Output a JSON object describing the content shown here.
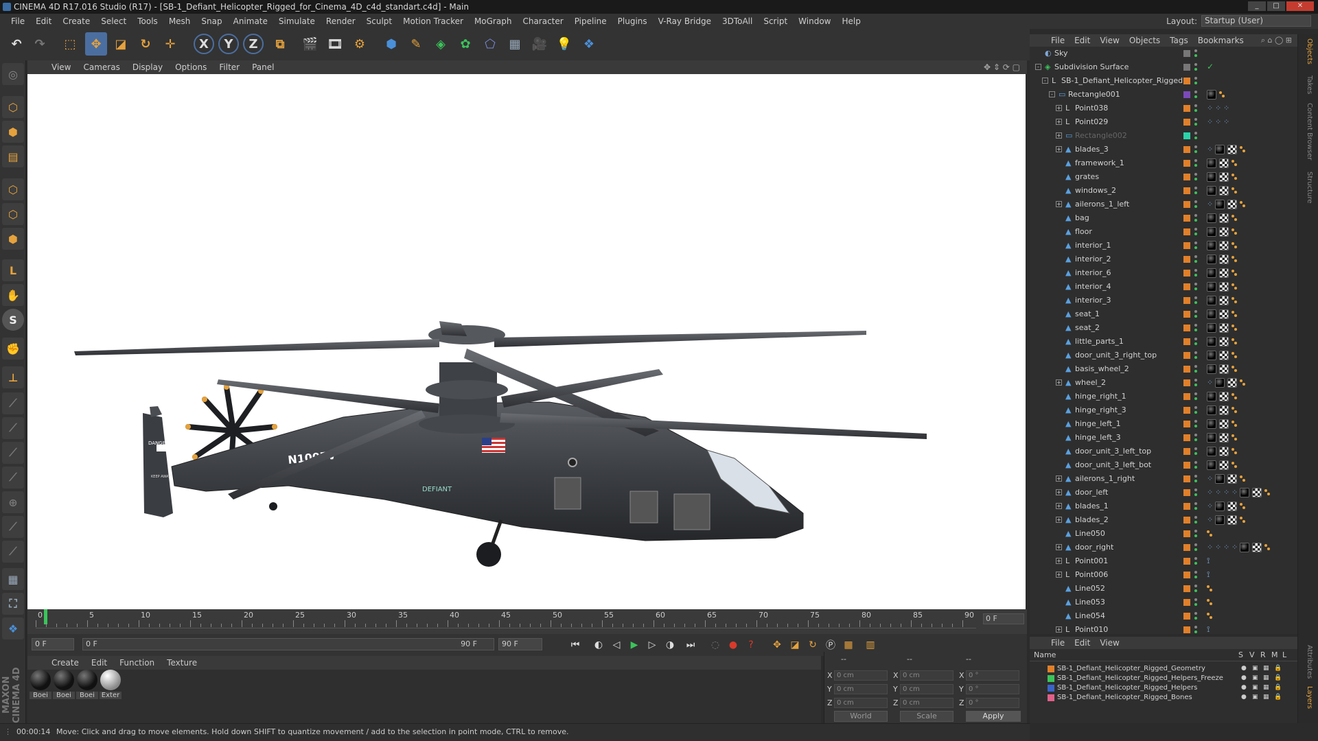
{
  "window": {
    "title": "CINEMA 4D R17.016 Studio (R17) - [SB-1_Defiant_Helicopter_Rigged_for_Cinema_4D_c4d_standart.c4d] - Main"
  },
  "menubar": {
    "items": [
      "File",
      "Edit",
      "Create",
      "Select",
      "Tools",
      "Mesh",
      "Snap",
      "Animate",
      "Simulate",
      "Render",
      "Sculpt",
      "Motion Tracker",
      "MoGraph",
      "Character",
      "Pipeline",
      "Plugins",
      "V-Ray Bridge",
      "3DToAll",
      "Script",
      "Window",
      "Help"
    ],
    "layout_label": "Layout:",
    "layout_value": "Startup (User)"
  },
  "viewport": {
    "menu": [
      "View",
      "Cameras",
      "Display",
      "Options",
      "Filter",
      "Panel"
    ],
    "model_text": {
      "registration": "N100FV",
      "tail_marking": "DANGER",
      "tail_sub": "KEEP AWAY",
      "logo": "DEFIANT"
    }
  },
  "timeline": {
    "ticks": [
      "0",
      "5",
      "10",
      "15",
      "20",
      "25",
      "30",
      "35",
      "40",
      "45",
      "50",
      "55",
      "60",
      "65",
      "70",
      "75",
      "80",
      "85",
      "90"
    ],
    "frame_field": "0 F",
    "start_field": "0 F",
    "range_start": "0 F",
    "range_end": "90 F",
    "end_field": "90 F"
  },
  "materials": {
    "menu": [
      "Create",
      "Edit",
      "Function",
      "Texture"
    ],
    "items": [
      "Boei",
      "Boei",
      "Boei",
      "Exter"
    ]
  },
  "coords": {
    "header_a": "--",
    "header_b": "--",
    "header_c": "--",
    "rows": [
      {
        "a": "X",
        "av": "0 cm",
        "b": "X",
        "bv": "0 cm",
        "c": "X",
        "cv": "0 °"
      },
      {
        "a": "Y",
        "av": "0 cm",
        "b": "Y",
        "bv": "0 cm",
        "c": "Y",
        "cv": "0 °"
      },
      {
        "a": "Z",
        "av": "0 cm",
        "b": "Z",
        "bv": "0 cm",
        "c": "Z",
        "cv": "0 °"
      }
    ],
    "mode_world": "World",
    "mode_scale": "Scale",
    "apply": "Apply"
  },
  "status": {
    "time": "00:00:14",
    "message": "Move: Click and drag to move elements. Hold down SHIFT to quantize movement / add to the selection in point mode, CTRL to remove."
  },
  "object_manager": {
    "menu": [
      "File",
      "Edit",
      "View",
      "Objects",
      "Tags",
      "Bookmarks"
    ],
    "objects": [
      {
        "name": "Sky",
        "depth": 0,
        "expand": "",
        "icon": "sky",
        "sw": "gray",
        "tags": []
      },
      {
        "name": "Subdivision Surface",
        "depth": 0,
        "expand": "-",
        "icon": "subd",
        "sw": "gray",
        "tags": [
          "check"
        ]
      },
      {
        "name": "SB-1_Defiant_Helicopter_Rigged",
        "depth": 1,
        "expand": "-",
        "icon": "null",
        "sw": "orange",
        "tags": []
      },
      {
        "name": "Rectangle001",
        "depth": 2,
        "expand": "-",
        "icon": "spline",
        "sw": "purple",
        "tags": [
          "ph",
          "or"
        ]
      },
      {
        "name": "Point038",
        "depth": 3,
        "expand": "+",
        "icon": "null",
        "sw": "orange",
        "tags": [
          "dots"
        ]
      },
      {
        "name": "Point029",
        "depth": 3,
        "expand": "+",
        "icon": "null",
        "sw": "orange",
        "tags": [
          "dots"
        ]
      },
      {
        "name": "Rectangle002",
        "depth": 3,
        "expand": "+",
        "icon": "spline",
        "sw": "teal",
        "tags": [],
        "dim": true
      },
      {
        "name": "blades_3",
        "depth": 3,
        "expand": "+",
        "icon": "poly",
        "sw": "orange",
        "tags": [
          "dotsm",
          "ph",
          "ck",
          "or"
        ]
      },
      {
        "name": "framework_1",
        "depth": 3,
        "expand": "",
        "icon": "poly",
        "sw": "orange",
        "tags": [
          "ph",
          "ck",
          "or"
        ]
      },
      {
        "name": "grates",
        "depth": 3,
        "expand": "",
        "icon": "poly",
        "sw": "orange",
        "tags": [
          "ph",
          "ck",
          "or"
        ]
      },
      {
        "name": "windows_2",
        "depth": 3,
        "expand": "",
        "icon": "poly",
        "sw": "orange",
        "tags": [
          "ph",
          "ck",
          "or"
        ]
      },
      {
        "name": "ailerons_1_left",
        "depth": 3,
        "expand": "+",
        "icon": "poly",
        "sw": "orange",
        "tags": [
          "dotsm",
          "ph",
          "ck",
          "or"
        ]
      },
      {
        "name": "bag",
        "depth": 3,
        "expand": "",
        "icon": "poly",
        "sw": "orange",
        "tags": [
          "ph",
          "ck",
          "or"
        ]
      },
      {
        "name": "floor",
        "depth": 3,
        "expand": "",
        "icon": "poly",
        "sw": "orange",
        "tags": [
          "ph",
          "ck",
          "or"
        ]
      },
      {
        "name": "interior_1",
        "depth": 3,
        "expand": "",
        "icon": "poly",
        "sw": "orange",
        "tags": [
          "ph",
          "ck",
          "or"
        ]
      },
      {
        "name": "interior_2",
        "depth": 3,
        "expand": "",
        "icon": "poly",
        "sw": "orange",
        "tags": [
          "ph",
          "ck",
          "or"
        ]
      },
      {
        "name": "interior_6",
        "depth": 3,
        "expand": "",
        "icon": "poly",
        "sw": "orange",
        "tags": [
          "ph",
          "ck",
          "or"
        ]
      },
      {
        "name": "interior_4",
        "depth": 3,
        "expand": "",
        "icon": "poly",
        "sw": "orange",
        "tags": [
          "ph",
          "ck",
          "or"
        ]
      },
      {
        "name": "interior_3",
        "depth": 3,
        "expand": "",
        "icon": "poly",
        "sw": "orange",
        "tags": [
          "ph",
          "ck",
          "or"
        ]
      },
      {
        "name": "seat_1",
        "depth": 3,
        "expand": "",
        "icon": "poly",
        "sw": "orange",
        "tags": [
          "ph",
          "ck",
          "or"
        ]
      },
      {
        "name": "seat_2",
        "depth": 3,
        "expand": "",
        "icon": "poly",
        "sw": "orange",
        "tags": [
          "ph",
          "ck",
          "or"
        ]
      },
      {
        "name": "little_parts_1",
        "depth": 3,
        "expand": "",
        "icon": "poly",
        "sw": "orange",
        "tags": [
          "ph",
          "ck",
          "or"
        ]
      },
      {
        "name": "door_unit_3_right_top",
        "depth": 3,
        "expand": "",
        "icon": "poly",
        "sw": "orange",
        "tags": [
          "ph",
          "ck",
          "or"
        ]
      },
      {
        "name": "basis_wheel_2",
        "depth": 3,
        "expand": "",
        "icon": "poly",
        "sw": "orange",
        "tags": [
          "ph",
          "ck",
          "or"
        ]
      },
      {
        "name": "wheel_2",
        "depth": 3,
        "expand": "+",
        "icon": "poly",
        "sw": "orange",
        "tags": [
          "dotsm",
          "ph",
          "ck",
          "or"
        ]
      },
      {
        "name": "hinge_right_1",
        "depth": 3,
        "expand": "",
        "icon": "poly",
        "sw": "orange",
        "tags": [
          "ph",
          "ck",
          "or"
        ]
      },
      {
        "name": "hinge_right_3",
        "depth": 3,
        "expand": "",
        "icon": "poly",
        "sw": "orange",
        "tags": [
          "ph",
          "ck",
          "or"
        ]
      },
      {
        "name": "hinge_left_1",
        "depth": 3,
        "expand": "",
        "icon": "poly",
        "sw": "orange",
        "tags": [
          "ph",
          "ck",
          "or"
        ]
      },
      {
        "name": "hinge_left_3",
        "depth": 3,
        "expand": "",
        "icon": "poly",
        "sw": "orange",
        "tags": [
          "ph",
          "ck",
          "or"
        ]
      },
      {
        "name": "door_unit_3_left_top",
        "depth": 3,
        "expand": "",
        "icon": "poly",
        "sw": "orange",
        "tags": [
          "ph",
          "ck",
          "or"
        ]
      },
      {
        "name": "door_unit_3_left_bot",
        "depth": 3,
        "expand": "",
        "icon": "poly",
        "sw": "orange",
        "tags": [
          "ph",
          "ck",
          "or"
        ]
      },
      {
        "name": "ailerons_1_right",
        "depth": 3,
        "expand": "+",
        "icon": "poly",
        "sw": "orange",
        "tags": [
          "dotsm",
          "ph",
          "ck",
          "or"
        ]
      },
      {
        "name": "door_left",
        "depth": 3,
        "expand": "+",
        "icon": "poly",
        "sw": "orange",
        "tags": [
          "dotsl",
          "ph",
          "ck",
          "or"
        ]
      },
      {
        "name": "blades_1",
        "depth": 3,
        "expand": "+",
        "icon": "poly",
        "sw": "orange",
        "tags": [
          "dotss",
          "ph",
          "ck",
          "or"
        ]
      },
      {
        "name": "blades_2",
        "depth": 3,
        "expand": "+",
        "icon": "poly",
        "sw": "orange",
        "tags": [
          "dotss",
          "ph",
          "ck",
          "or"
        ]
      },
      {
        "name": "Line050",
        "depth": 3,
        "expand": "",
        "icon": "poly",
        "sw": "orange",
        "tags": [
          "or"
        ]
      },
      {
        "name": "door_right",
        "depth": 3,
        "expand": "+",
        "icon": "poly",
        "sw": "orange",
        "tags": [
          "dotsl",
          "ph",
          "ck",
          "or"
        ]
      },
      {
        "name": "Point001",
        "depth": 3,
        "expand": "+",
        "icon": "null",
        "sw": "orange",
        "tags": [
          "ik"
        ]
      },
      {
        "name": "Point006",
        "depth": 3,
        "expand": "+",
        "icon": "null",
        "sw": "orange",
        "tags": [
          "ik"
        ]
      },
      {
        "name": "Line052",
        "depth": 3,
        "expand": "",
        "icon": "poly",
        "sw": "orange",
        "tags": [
          "or"
        ]
      },
      {
        "name": "Line053",
        "depth": 3,
        "expand": "",
        "icon": "poly",
        "sw": "orange",
        "tags": [
          "or"
        ]
      },
      {
        "name": "Line054",
        "depth": 3,
        "expand": "",
        "icon": "poly",
        "sw": "orange",
        "tags": [
          "or"
        ]
      },
      {
        "name": "Point010",
        "depth": 3,
        "expand": "+",
        "icon": "null",
        "sw": "orange",
        "tags": [
          "ik"
        ]
      }
    ]
  },
  "layer_manager": {
    "menu": [
      "File",
      "Edit",
      "View"
    ],
    "col_name": "Name",
    "cols": [
      "S",
      "V",
      "R",
      "M",
      "L"
    ],
    "layers": [
      {
        "name": "SB-1_Defiant_Helicopter_Rigged_Geometry",
        "color": "#e0802a"
      },
      {
        "name": "SB-1_Defiant_Helicopter_Rigged_Helpers_Freeze",
        "color": "#3cc45a"
      },
      {
        "name": "SB-1_Defiant_Helicopter_Rigged_Helpers",
        "color": "#3a64c8"
      },
      {
        "name": "SB-1_Defiant_Helicopter_Rigged_Bones",
        "color": "#e0608a"
      }
    ]
  },
  "side_tabs": [
    "Objects",
    "Takes",
    "Content Browser",
    "Structure"
  ],
  "side_tabs_bottom": [
    "Attributes",
    "Layers"
  ],
  "colors": {
    "accent_orange": "#e6a23c",
    "accent_blue": "#4a90d9",
    "playhead_green": "#3bc45b",
    "record_red": "#d93a2b"
  }
}
